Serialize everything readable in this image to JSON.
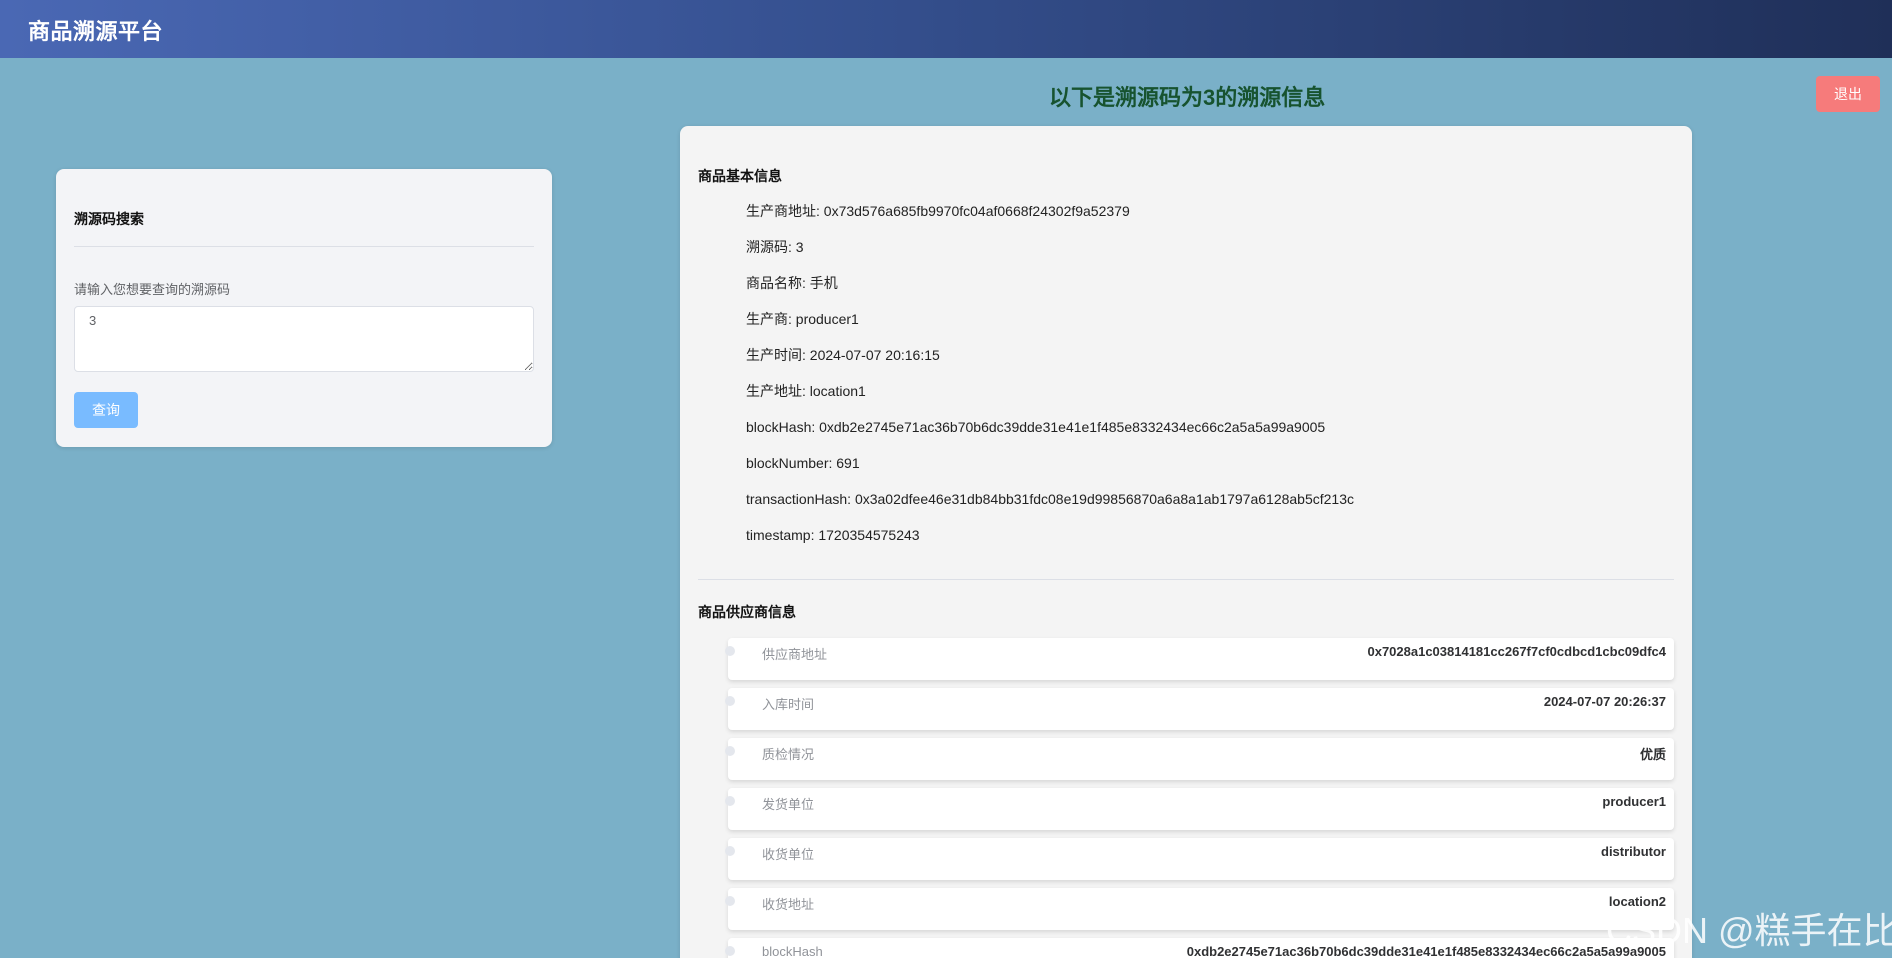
{
  "header": {
    "app_title": "商品溯源平台"
  },
  "page": {
    "heading": "以下是溯源码为3的溯源信息",
    "logout_label": "退出"
  },
  "search": {
    "title": "溯源码搜索",
    "label": "请输入您想要查询的溯源码",
    "input_value": "3",
    "button_label": "查询"
  },
  "basic_info": {
    "title": "商品基本信息",
    "items": [
      "生产商地址: 0x73d576a685fb9970fc04af0668f24302f9a52379",
      "溯源码: 3",
      "商品名称: 手机",
      "生产商: producer1",
      "生产时间: 2024-07-07 20:16:15",
      "生产地址: location1",
      "blockHash: 0xdb2e2745e71ac36b70b6dc39dde31e41e1f485e8332434ec66c2a5a5a99a9005",
      "blockNumber: 691",
      "transactionHash: 0x3a02dfee46e31db84bb31fdc08e19d99856870a6a8a1ab1797a6128ab5cf213c",
      "timestamp: 1720354575243"
    ]
  },
  "supplier_info": {
    "title": "商品供应商信息",
    "rows": [
      {
        "label": "供应商地址",
        "value": "0x7028a1c03814181cc267f7cf0cdbcd1cbc09dfc4"
      },
      {
        "label": "入库时间",
        "value": "2024-07-07 20:26:37"
      },
      {
        "label": "质检情况",
        "value": "优质"
      },
      {
        "label": "发货单位",
        "value": "producer1"
      },
      {
        "label": "收货单位",
        "value": "distributor"
      },
      {
        "label": "收货地址",
        "value": "location2"
      },
      {
        "label": "blockHash",
        "value": "0xdb2e2745e71ac36b70b6dc39dde31e41e1f485e8332434ec66c2a5a5a99a9005"
      }
    ]
  },
  "watermark": "CSDN @糕手在比"
}
